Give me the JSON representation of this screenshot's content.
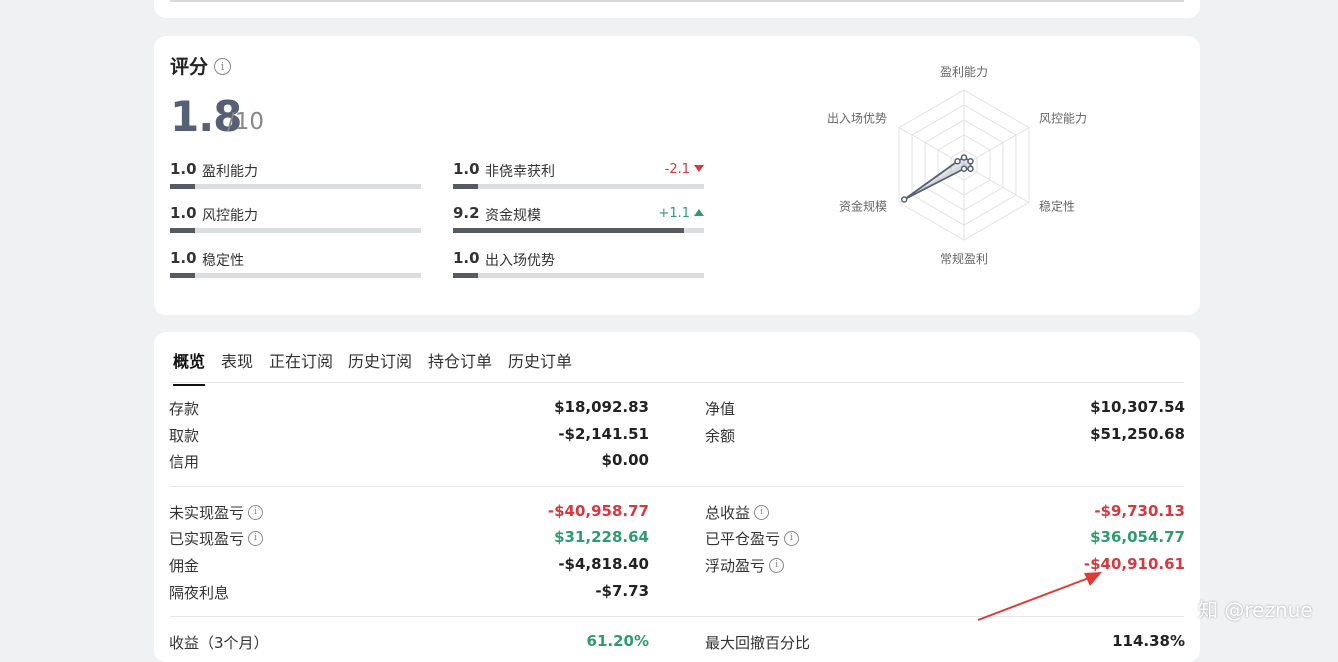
{
  "score": {
    "title": "评分",
    "value": "1.8",
    "denominator": "/10",
    "metrics": [
      {
        "value": "1.0",
        "label": "盈利能力",
        "change": "",
        "fill": 0.1
      },
      {
        "value": "1.0",
        "label": "非侥幸获利",
        "change": "-2.1",
        "fill": 0.1
      },
      {
        "value": "1.0",
        "label": "风控能力",
        "change": "",
        "fill": 0.1
      },
      {
        "value": "9.2",
        "label": "资金规模",
        "change": "+1.1",
        "fill": 0.92
      },
      {
        "value": "1.0",
        "label": "稳定性",
        "change": "",
        "fill": 0.1
      },
      {
        "value": "1.0",
        "label": "出入场优势",
        "change": "",
        "fill": 0.1
      }
    ]
  },
  "radar": {
    "labels": [
      "盈利能力",
      "风控能力",
      "稳定性",
      "常规盈利",
      "资金规模",
      "出入场优势"
    ],
    "values": [
      1.0,
      1.0,
      1.0,
      0.5,
      9.2,
      1.0
    ],
    "max": 10,
    "color": "#556074"
  },
  "overview": {
    "tabs": [
      "概览",
      "表现",
      "正在订阅",
      "历史订阅",
      "持仓订单",
      "历史订单"
    ],
    "active_tab": "概览",
    "left": [
      {
        "label": "存款",
        "value": "$18,092.83"
      },
      {
        "label": "取款",
        "value": "-$2,141.51"
      },
      {
        "label": "信用",
        "value": "$0.00"
      },
      {
        "label": "未实现盈亏",
        "value": "-$40,958.77",
        "status": "neg"
      },
      {
        "label": "已实现盈亏",
        "value": "$31,228.64",
        "status": "pos"
      },
      {
        "label": "佣金",
        "value": "-$4,818.40"
      },
      {
        "label": "隔夜利息",
        "value": "-$7.73"
      },
      {
        "label": "收益（3个月）",
        "value": "61.20%",
        "status": "pos"
      }
    ],
    "right": [
      {
        "label": "净值",
        "value": "$10,307.54"
      },
      {
        "label": "余额",
        "value": "$51,250.68"
      },
      {
        "label": "总收益",
        "value": "-$9,730.13",
        "status": "neg"
      },
      {
        "label": "已平仓盈亏",
        "value": "$36,054.77",
        "status": "pos"
      },
      {
        "label": "浮动盈亏",
        "value": "-$40,910.61",
        "status": "neg"
      },
      {
        "label": "最大回撤百分比",
        "value": "114.38%"
      }
    ]
  },
  "watermark": "知 @reznue",
  "colors": {
    "negative": "#d9363e",
    "positive": "#2e9c6e",
    "arrow": "#e23b35"
  }
}
